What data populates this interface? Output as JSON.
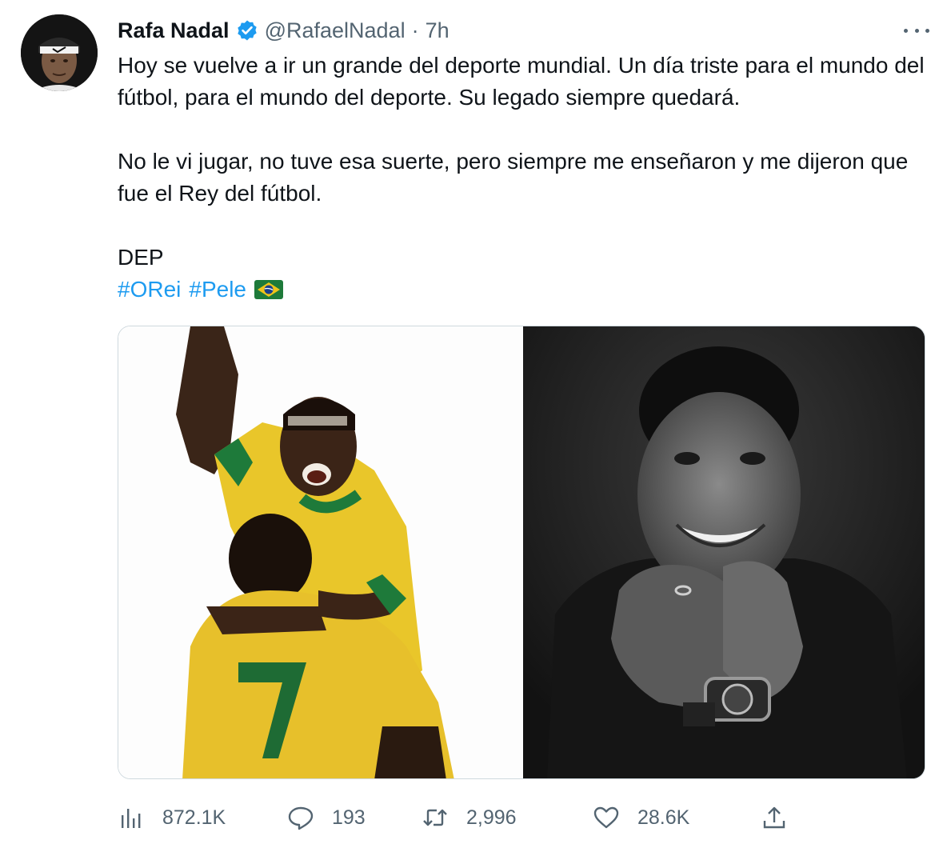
{
  "author": {
    "name": "Rafa Nadal",
    "handle": "@RafaelNadal",
    "separator": "·",
    "time": "7h",
    "verified_color": "#1d9bf0"
  },
  "body": {
    "paragraph1": "Hoy se vuelve a ir un grande del deporte mundial. Un día triste para el mundo del fútbol, para el mundo del deporte. Su legado siempre quedará.",
    "paragraph2": "No le vi jugar, no tuve esa suerte, pero siempre me enseñaron y me dijeron que fue el Rey del fútbol.",
    "paragraph3": "DEP",
    "hashtags": [
      "#ORei",
      "#Pele"
    ],
    "flag_icon": "brazil-flag-icon"
  },
  "colors": {
    "link": "#1d9bf0",
    "secondary_text": "#536471",
    "brazil_yellow": "#f0c419",
    "brazil_green": "#1e7a3a"
  },
  "actions": {
    "views": "872.1K",
    "replies": "193",
    "retweets": "2,996",
    "likes": "28.6K"
  }
}
